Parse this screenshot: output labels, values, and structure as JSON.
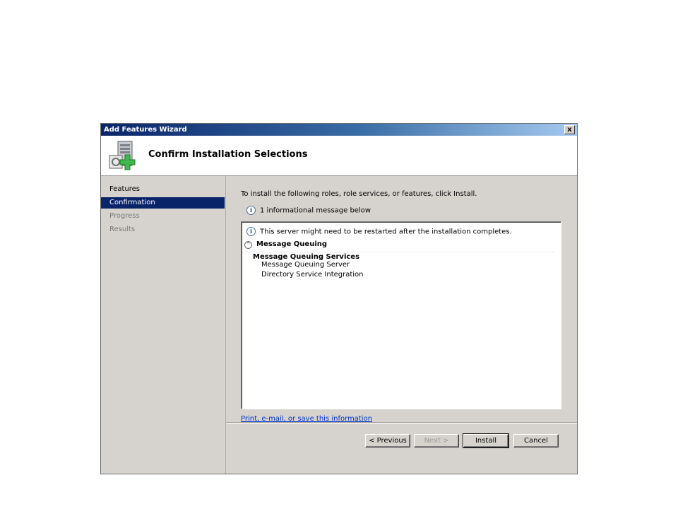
{
  "window": {
    "title": "Add Features Wizard",
    "close_label": "x"
  },
  "header": {
    "title": "Confirm Installation Selections",
    "icon": "server-add-icon"
  },
  "nav": {
    "items": [
      {
        "label": "Features",
        "state": "done"
      },
      {
        "label": "Confirmation",
        "state": "current"
      },
      {
        "label": "Progress",
        "state": "future"
      },
      {
        "label": "Results",
        "state": "future"
      }
    ]
  },
  "main": {
    "instruction": "To install the following roles, role services, or features, click Install.",
    "info_message": "1 informational message below",
    "list": {
      "info": "This server might need to be restarted after the installation completes.",
      "feature": "Message Queuing",
      "service_group": "Message Queuing Services",
      "items": [
        "Message Queuing Server",
        "Directory Service Integration"
      ]
    },
    "link": "Print, e-mail, or save this information"
  },
  "buttons": {
    "previous": "< Previous",
    "next": "Next >",
    "install": "Install",
    "cancel": "Cancel"
  },
  "colors": {
    "selection": "#0a246a",
    "face": "#d6d3ce",
    "link": "#0033cc"
  }
}
